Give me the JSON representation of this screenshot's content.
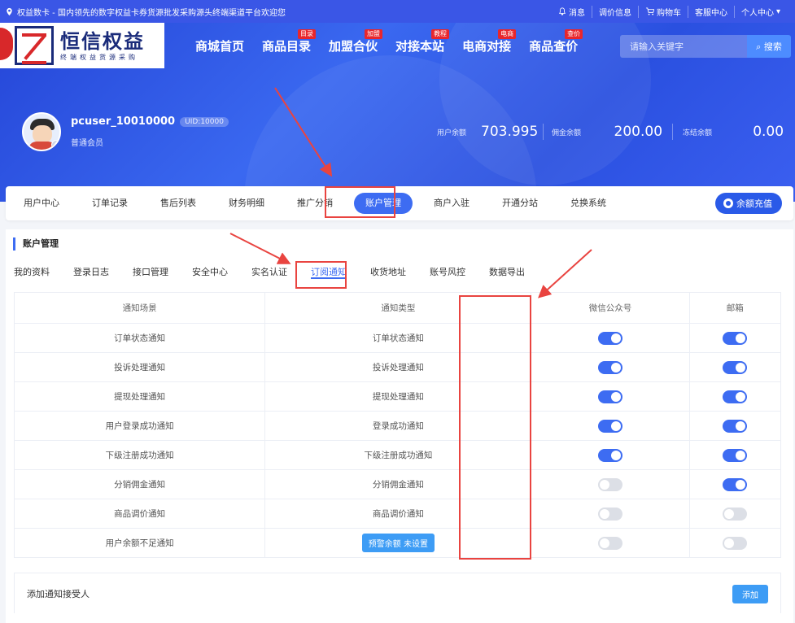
{
  "topbar": {
    "site_title": "权益数卡 - 国内领先的数字权益卡券货源批发采购源头终端渠道平台欢迎您",
    "links": [
      {
        "label": "消息",
        "icon": "bell-icon"
      },
      {
        "label": "调价信息",
        "icon": ""
      },
      {
        "label": "购物车",
        "icon": "cart-icon"
      },
      {
        "label": "客服中心",
        "icon": ""
      },
      {
        "label": "个人中心",
        "icon": "chevron-down-icon"
      }
    ]
  },
  "logo": {
    "name": "恒信权益",
    "slogan": "终端权益货源采购"
  },
  "main_nav": [
    {
      "label": "商城首页",
      "tag": ""
    },
    {
      "label": "商品目录",
      "tag": "目录"
    },
    {
      "label": "加盟合伙",
      "tag": "加盟"
    },
    {
      "label": "对接本站",
      "tag": "教程"
    },
    {
      "label": "电商对接",
      "tag": "电商"
    },
    {
      "label": "商品查价",
      "tag": "查价"
    }
  ],
  "search": {
    "placeholder": "请输入关键字",
    "button_label": "搜索"
  },
  "profile": {
    "username": "pcuser_10010000",
    "uid": "UID:10000",
    "level": "普通会员"
  },
  "balances": [
    {
      "label": "用户余额",
      "value": "703.995"
    },
    {
      "label": "佣金余额",
      "value": "200.00"
    },
    {
      "label": "冻结余额",
      "value": "0.00"
    }
  ],
  "user_nav": {
    "tabs": [
      "用户中心",
      "订单记录",
      "售后列表",
      "财务明细",
      "推广分销",
      "账户管理",
      "商户入驻",
      "开通分站",
      "兑换系统"
    ],
    "active": "账户管理",
    "recharge_label": "余额充值"
  },
  "section_title": "账户管理",
  "sub_tabs": [
    "我的资料",
    "登录日志",
    "接口管理",
    "安全中心",
    "实名认证",
    "订阅通知",
    "收货地址",
    "账号风控",
    "数据导出"
  ],
  "active_sub_tab": "订阅通知",
  "table": {
    "headers": [
      "通知场景",
      "通知类型",
      "微信公众号",
      "邮箱"
    ],
    "rows": [
      {
        "scene": "订单状态通知",
        "type": "订单状态通知",
        "wechat": true,
        "email": true
      },
      {
        "scene": "投诉处理通知",
        "type": "投诉处理通知",
        "wechat": true,
        "email": true
      },
      {
        "scene": "提现处理通知",
        "type": "提现处理通知",
        "wechat": true,
        "email": true
      },
      {
        "scene": "用户登录成功通知",
        "type": "登录成功通知",
        "wechat": true,
        "email": true
      },
      {
        "scene": "下级注册成功通知",
        "type": "下级注册成功通知",
        "wechat": true,
        "email": true
      },
      {
        "scene": "分销佣金通知",
        "type": "分销佣金通知",
        "wechat": false,
        "email": true
      },
      {
        "scene": "商品调价通知",
        "type": "商品调价通知",
        "wechat": false,
        "email": false
      },
      {
        "scene": "用户余额不足通知",
        "type": "",
        "type_button": "预警余额 未设置",
        "wechat": false,
        "email": false
      }
    ]
  },
  "receivers": {
    "label": "添加通知接受人",
    "add_label": "添加"
  },
  "colors": {
    "primary": "#3d6cf2",
    "header_bg": "#3a56e6",
    "annotation_red": "#e94440"
  }
}
